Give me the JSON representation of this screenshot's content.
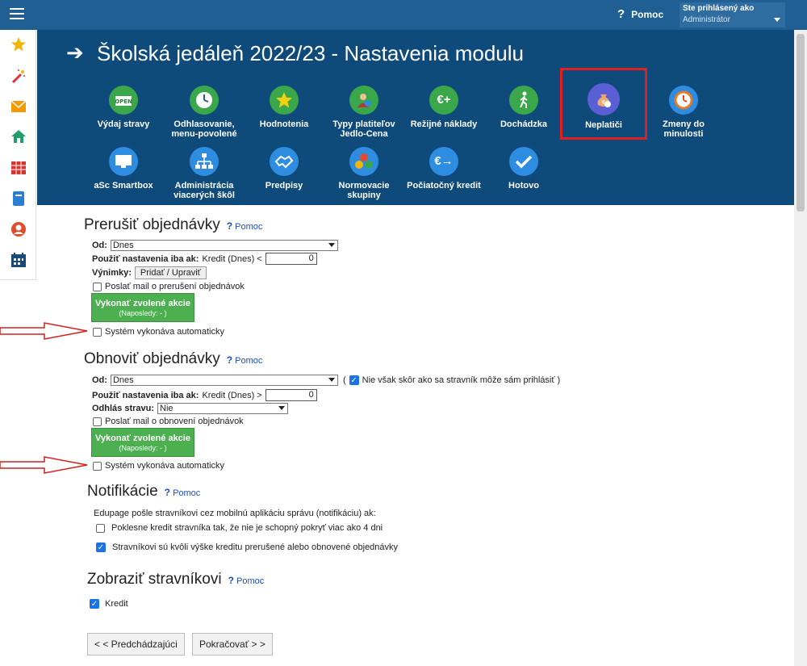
{
  "topbar": {
    "help_label": "Pomoc",
    "user_line1": "Ste prihlásený ako",
    "user_line2": "Administrátor"
  },
  "header": {
    "title": "Školská jedáleň 2022/23 - Nastavenia modulu",
    "modules_row1": [
      {
        "label": "Výdaj stravy",
        "icon": "open-sign-icon"
      },
      {
        "label": "Odhlasovanie, menu-povolené",
        "icon": "clock-icon"
      },
      {
        "label": "Hodnotenia",
        "icon": "star-icon"
      },
      {
        "label": "Typy platiteľov Jedlo-Cena",
        "icon": "person-euro-icon"
      },
      {
        "label": "Režijné náklady",
        "icon": "euro-plus-icon"
      },
      {
        "label": "Dochádzka",
        "icon": "walking-icon"
      },
      {
        "label": "Neplatiči",
        "icon": "money-bag-icon"
      },
      {
        "label": "Zmeny do minulosti",
        "icon": "past-clock-icon"
      }
    ],
    "modules_row2": [
      {
        "label": "aSc Smartbox",
        "icon": "monitor-icon"
      },
      {
        "label": "Administrácia viacerých škôl",
        "icon": "hierarchy-icon"
      },
      {
        "label": "Predpisy",
        "icon": "handshake-icon"
      },
      {
        "label": "Normovacie skupiny",
        "icon": "groups-icon"
      },
      {
        "label": "Počiatočný kredit",
        "icon": "euro-arrow-icon"
      },
      {
        "label": "Hotovo",
        "icon": "check-icon"
      }
    ]
  },
  "sec1": {
    "title": "Prerušiť objednávky",
    "help": "Pomoc",
    "od_label": "Od:",
    "od_value": "Dnes",
    "pouzit_label": "Použiť nastavenia iba ak:",
    "pouzit_text": "Kredit (Dnes) <",
    "pouzit_value": "0",
    "vynimky_label": "Výnimky:",
    "vynimky_btn": "Pridať / Upraviť",
    "mail_label": "Poslať mail o prerušení objednávok",
    "exec_btn": "Vykonať zvolené akcie",
    "exec_sub": "(Naposledy: - )",
    "auto_label": "Systém vykonáva automaticky"
  },
  "sec2": {
    "title": "Obnoviť objednávky",
    "help": "Pomoc",
    "od_label": "Od:",
    "od_value": "Dnes",
    "paren_open": "(",
    "note": "Nie však skôr ako sa stravník môže sám prihlásiť )",
    "pouzit_label": "Použiť nastavenia iba ak:",
    "pouzit_text": "Kredit (Dnes) >",
    "pouzit_value": "0",
    "odhlas_label": "Odhlás stravu:",
    "odhlas_value": "Nie",
    "mail_label": "Poslať mail o obnovení objednávok",
    "exec_btn": "Vykonať zvolené akcie",
    "exec_sub": "(Naposledy: - )",
    "auto_label": "Systém vykonáva automaticky"
  },
  "sec3": {
    "title": "Notifikácie",
    "help": "Pomoc",
    "intro": "Edupage pošle stravníkovi cez mobilnú aplikáciu správu (notifikáciu) ak:",
    "opt1": "Poklesne kredit stravníka tak, že nie je schopný pokryť viac ako 4 dni",
    "opt2": "Stravníkovi sú kvôli výške kreditu prerušené alebo obnovené objednávky"
  },
  "sec4": {
    "title": "Zobraziť stravníkovi",
    "help": "Pomoc",
    "opt1": "Kredit"
  },
  "nav": {
    "prev": "< < Predchádzajúci",
    "next": "Pokračovať > >"
  },
  "colors": {
    "topbar": "#1f5f93",
    "header": "#0e4a7a",
    "green_button": "#4caf50",
    "highlight": "#e02020"
  }
}
